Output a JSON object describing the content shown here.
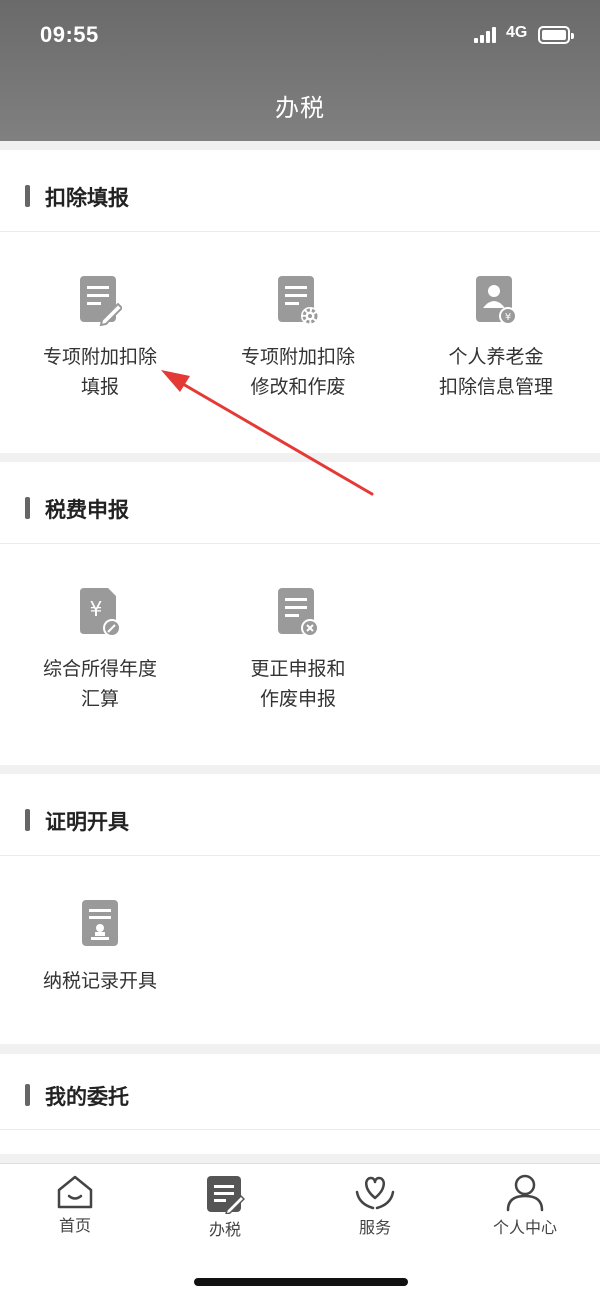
{
  "status_bar": {
    "time": "09:55",
    "network": "4G"
  },
  "header": {
    "title": "办税"
  },
  "sections": [
    {
      "title": "扣除填报",
      "items": [
        {
          "line1": "专项附加扣除",
          "line2": "填报",
          "icon": "document-edit-icon"
        },
        {
          "line1": "专项附加扣除",
          "line2": "修改和作废",
          "icon": "document-gear-icon"
        },
        {
          "line1": "个人养老金",
          "line2": "扣除信息管理",
          "icon": "person-yuan-icon"
        }
      ]
    },
    {
      "title": "税费申报",
      "items": [
        {
          "line1": "综合所得年度",
          "line2": "汇算",
          "icon": "yuan-document-icon"
        },
        {
          "line1": "更正申报和",
          "line2": "作废申报",
          "icon": "document-cancel-icon"
        }
      ]
    },
    {
      "title": "证明开具",
      "items": [
        {
          "line1": "纳税记录开具",
          "icon": "certificate-icon"
        }
      ]
    },
    {
      "title": "我的委托",
      "items": []
    }
  ],
  "tabbar": [
    {
      "label": "首页",
      "icon": "home-icon"
    },
    {
      "label": "办税",
      "icon": "tax-icon",
      "active": true
    },
    {
      "label": "服务",
      "icon": "heart-hands-icon"
    },
    {
      "label": "个人中心",
      "icon": "user-icon"
    }
  ],
  "annotation_color": "#e53935"
}
